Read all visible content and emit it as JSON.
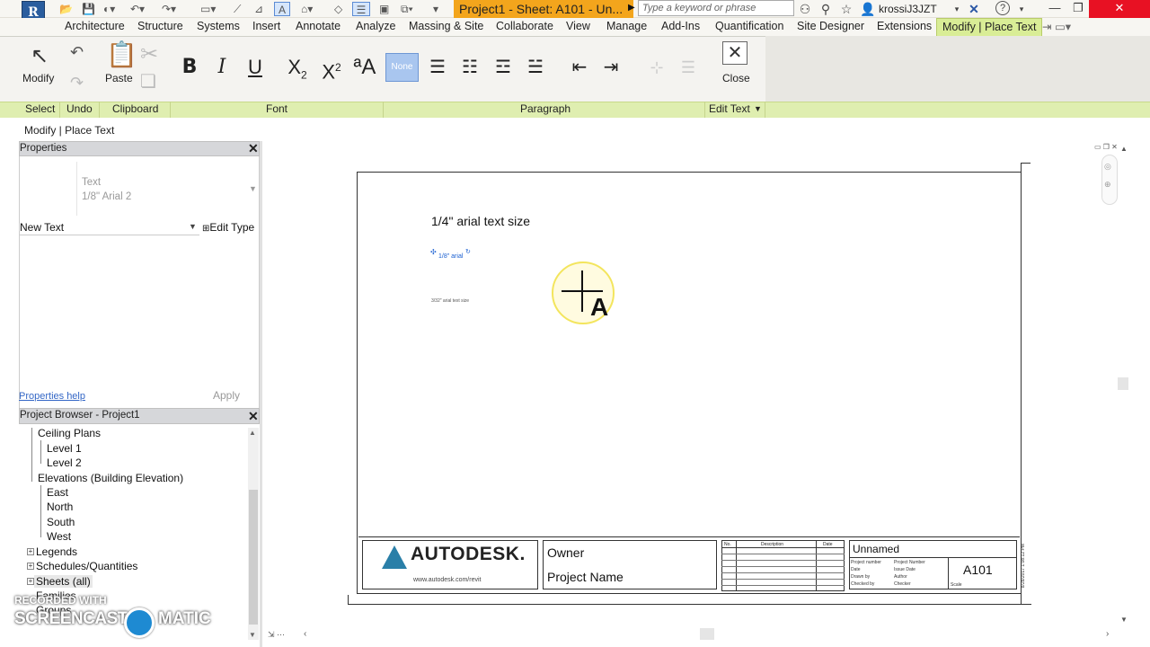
{
  "title_bar": {
    "doc_title": "Project1 - Sheet: A101 - Un...",
    "search_placeholder": "Type a keyword or phrase",
    "user": "krossiJ3JZT",
    "help": "?"
  },
  "tabs": [
    "Architecture",
    "Structure",
    "Systems",
    "Insert",
    "Annotate",
    "Analyze",
    "Massing & Site",
    "Collaborate",
    "View",
    "Manage",
    "Add-Ins",
    "Quantification",
    "Site Designer",
    "Extensions",
    "Modify | Place Text"
  ],
  "ribbon": {
    "modify_label": "Modify",
    "paste_label": "Paste",
    "close_label": "Close",
    "style_none": "None",
    "panels": {
      "select": "Select",
      "undo": "Undo",
      "clipboard": "Clipboard",
      "font": "Font",
      "paragraph": "Paragraph",
      "edit_text": "Edit Text"
    },
    "font_buttons": [
      "B",
      "I",
      "U"
    ]
  },
  "context_bar": "Modify | Place Text",
  "properties": {
    "title": "Properties",
    "type_category": "Text",
    "type_name": "1/8\" Arial 2",
    "instance": "New Text",
    "edit_type": "Edit Type",
    "help": "Properties help",
    "apply": "Apply"
  },
  "project_browser": {
    "title": "Project Browser - Project1",
    "items": [
      "Ceiling Plans",
      "Level 1",
      "Level 2",
      "Elevations (Building Elevation)",
      "East",
      "North",
      "South",
      "West",
      "Legends",
      "Schedules/Quantities",
      "Sheets (all)",
      "Families",
      "Groups"
    ]
  },
  "canvas": {
    "text_quarter": "1/4\" arial text size",
    "text_eighth": "1/8\" arial",
    "text_small": "3/32\" arial text size"
  },
  "title_block": {
    "logo": "AUTODESK.",
    "url": "www.autodesk.com/revit",
    "owner": "Owner",
    "project": "Project Name",
    "rev_headers": [
      "No.",
      "Description",
      "Date"
    ],
    "sheet_name": "Unnamed",
    "sheet_number": "A101",
    "info_labels": [
      "Project number",
      "Date",
      "Drawn by",
      "Checked by"
    ],
    "info_values": [
      "Project Number",
      "Issue Date",
      "Author",
      "Checker"
    ],
    "scale_label": "Scale",
    "timestamp": "8/28/2017 1:08:12 PM"
  },
  "watermark": {
    "recorded": "RECORDED WITH",
    "brand_left": "SCREENCAST",
    "brand_right": "MATIC"
  }
}
